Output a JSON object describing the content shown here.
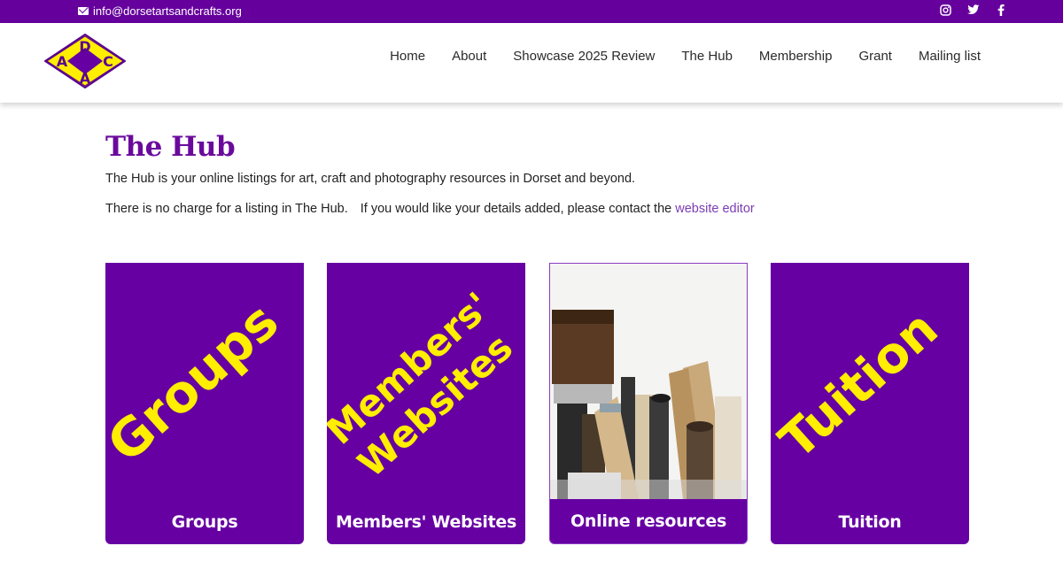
{
  "topbar": {
    "email": "info@dorsetartsandcrafts.org",
    "socials": [
      {
        "name": "instagram-icon",
        "glyph": "◎"
      },
      {
        "name": "twitter-icon",
        "glyph": "🐦"
      },
      {
        "name": "facebook-icon",
        "glyph": "f"
      }
    ]
  },
  "logo": {
    "letters": [
      "D",
      "A",
      "C",
      "A"
    ]
  },
  "nav": [
    "Home",
    "About",
    "Showcase 2025 Review",
    "The Hub",
    "Membership",
    "Grant",
    "Mailing list"
  ],
  "page": {
    "title": "The Hub",
    "intro": "The Hub is your online listings for art, craft and photography resources in Dorset and beyond.",
    "charge_text": "There is no charge for a listing in The Hub.",
    "contact_text": "If you would like your details added, please contact the",
    "contact_link": "website editor"
  },
  "cards": [
    {
      "label": "Groups",
      "big_text": [
        "Groups"
      ]
    },
    {
      "label": "Members' Websites",
      "big_text": [
        "Members'",
        "Websites"
      ]
    },
    {
      "label": "Online resources",
      "big_text": []
    },
    {
      "label": "Tuition",
      "big_text": [
        "Tuition"
      ]
    }
  ],
  "colors": {
    "brand_purple": "#65009c",
    "accent_yellow": "#ffee00",
    "link": "#7b3db4"
  }
}
